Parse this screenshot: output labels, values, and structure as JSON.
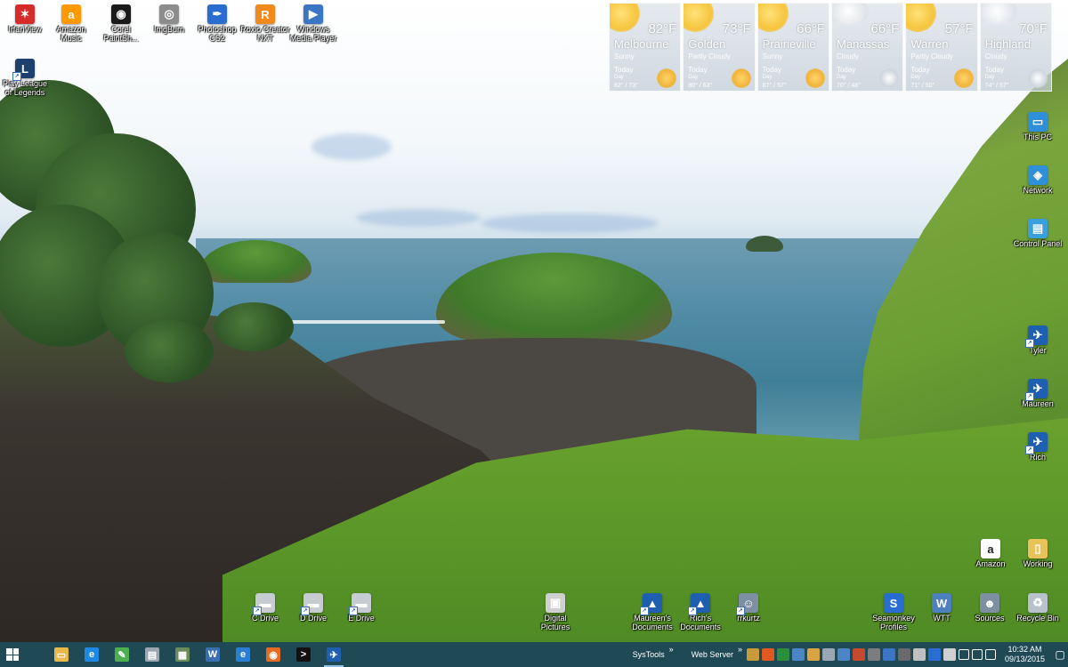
{
  "desktop": {
    "icons_top": [
      {
        "label": "IrfanView",
        "name": "irfanview-icon",
        "color": "#d62b2b",
        "glyph": "✶"
      },
      {
        "label": "Amazon Music",
        "name": "amazon-music-icon",
        "color": "#ff9900",
        "glyph": "a"
      },
      {
        "label": "Corel PaintSh...",
        "name": "corel-paintshop-icon",
        "color": "#1a1a1a",
        "glyph": "◉"
      },
      {
        "label": "ImgBurn",
        "name": "imgburn-icon",
        "color": "#8c8c8c",
        "glyph": "◎"
      },
      {
        "label": "Photoshop CS2",
        "name": "photoshop-icon",
        "color": "#2a6dd1",
        "glyph": "✒"
      },
      {
        "label": "Roxio Creator NXT",
        "name": "roxio-creator-icon",
        "color": "#f08a1c",
        "glyph": "R"
      },
      {
        "label": "Windows Media Player",
        "name": "windows-media-player-icon",
        "color": "#3b76c4",
        "glyph": "▶"
      }
    ],
    "icon_league": {
      "label": "Play League of Legends",
      "name": "league-of-legends-icon",
      "color": "#1c3f6e",
      "glyph": "L"
    },
    "icons_right": [
      {
        "label": "This PC",
        "name": "this-pc-icon",
        "color": "#2f8fd8",
        "glyph": "▭"
      },
      {
        "label": "Network",
        "name": "network-icon",
        "color": "#2f8fd8",
        "glyph": "◈"
      },
      {
        "label": "Control Panel",
        "name": "control-panel-icon",
        "color": "#3aa0dd",
        "glyph": "▤"
      },
      {
        "label": "Tyler",
        "name": "tyler-shortcut-icon",
        "color": "#1f5fb0",
        "glyph": "✈"
      },
      {
        "label": "Maureen",
        "name": "maureen-shortcut-icon",
        "color": "#1f5fb0",
        "glyph": "✈"
      },
      {
        "label": "Rich",
        "name": "rich-shortcut-icon",
        "color": "#1f5fb0",
        "glyph": "✈"
      }
    ],
    "icons_bottom_right": [
      {
        "label": "Amazon",
        "name": "amazon-icon",
        "color": "#ffffff",
        "glyph": "a"
      },
      {
        "label": "Working",
        "name": "working-folder-icon",
        "color": "#e8c35a",
        "glyph": "▯"
      }
    ],
    "icons_bottom": [
      {
        "label": "C Drive",
        "name": "c-drive-icon",
        "color": "#c7ccd2",
        "glyph": "▬"
      },
      {
        "label": "D Drive",
        "name": "d-drive-icon",
        "color": "#c7ccd2",
        "glyph": "▬"
      },
      {
        "label": "E Drive",
        "name": "e-drive-icon",
        "color": "#c7ccd2",
        "glyph": "▬"
      },
      {
        "label": "Digital Pictures",
        "name": "digital-pictures-icon",
        "color": "#d0d0d0",
        "glyph": "▣"
      },
      {
        "label": "Maureen's Documents",
        "name": "maureens-documents-icon",
        "color": "#1f5fb0",
        "glyph": "▲"
      },
      {
        "label": "Rich's Documents",
        "name": "richs-documents-icon",
        "color": "#1f5fb0",
        "glyph": "▲"
      },
      {
        "label": "rrkurtz",
        "name": "rrkurtz-icon",
        "color": "#7d8fa0",
        "glyph": "☺"
      },
      {
        "label": "Seamonkey Profiles",
        "name": "seamonkey-profiles-icon",
        "color": "#2a6dd1",
        "glyph": "S"
      },
      {
        "label": "WTT",
        "name": "wtt-icon",
        "color": "#4e7fbf",
        "glyph": "W"
      },
      {
        "label": "Sources",
        "name": "sources-icon",
        "color": "#7d8fa0",
        "glyph": "☻"
      },
      {
        "label": "Recycle Bin",
        "name": "recycle-bin-icon",
        "color": "#b8c2cc",
        "glyph": "♻"
      }
    ]
  },
  "weather": [
    {
      "temp": "82°F",
      "city": "Melbourne",
      "cond": "Sunny",
      "today": "Today",
      "day": "Day",
      "range": "82° / 73°",
      "icon": "sun"
    },
    {
      "temp": "73°F",
      "city": "Golden",
      "cond": "Partly Cloudy",
      "today": "Today",
      "day": "Day",
      "range": "80° / 63°",
      "icon": "sun"
    },
    {
      "temp": "66°F",
      "city": "Prairieville",
      "cond": "Sunny",
      "today": "Today",
      "day": "Day",
      "range": "87° / 57°",
      "icon": "sun"
    },
    {
      "temp": "66°F",
      "city": "Manassas",
      "cond": "Cloudy",
      "today": "Today",
      "day": "Day",
      "range": "70° / 48°",
      "icon": "cloud"
    },
    {
      "temp": "57°F",
      "city": "Warren",
      "cond": "Partly Cloudy",
      "today": "Today",
      "day": "Day",
      "range": "71° / 50°",
      "icon": "sun"
    },
    {
      "temp": "70°F",
      "city": "Highland",
      "cond": "Cloudy",
      "today": "Today",
      "day": "Day",
      "range": "74° / 57°",
      "icon": "cloud"
    }
  ],
  "taskbar": {
    "pinned": [
      {
        "name": "file-explorer-icon",
        "color": "#e8b84a",
        "glyph": "▭"
      },
      {
        "name": "edge-icon",
        "color": "#1e88e5",
        "glyph": "e"
      },
      {
        "name": "green-app-icon",
        "color": "#4caf50",
        "glyph": "✎"
      },
      {
        "name": "notepad-icon",
        "color": "#9aa6b2",
        "glyph": "▤"
      },
      {
        "name": "calculator-app-icon",
        "color": "#6c8b5a",
        "glyph": "▦"
      },
      {
        "name": "word-doc-icon",
        "color": "#3a6fb3",
        "glyph": "W"
      },
      {
        "name": "internet-explorer-icon",
        "color": "#2a7fd4",
        "glyph": "e"
      },
      {
        "name": "firefox-icon",
        "color": "#e66a1f",
        "glyph": "◉"
      },
      {
        "name": "command-prompt-icon",
        "color": "#111111",
        "glyph": ">"
      },
      {
        "name": "seamonkey-icon",
        "color": "#1f5fb0",
        "glyph": "✈"
      }
    ],
    "toolbars": [
      "SysTools",
      "Web Server"
    ],
    "tray_colors": [
      "#c79a3a",
      "#e05a1f",
      "#2c8e3a",
      "#4a86c5",
      "#d9a441",
      "#9aa6b2",
      "#4a86c5",
      "#c34a2c",
      "#7d7d7d",
      "#3b76c4",
      "#6a6a6a",
      "#c0c0c0",
      "#2a6dd1",
      "#d0d0d0",
      "#ffffff",
      "#ffffff",
      "#ffffff"
    ],
    "clock": {
      "time": "10:32 AM",
      "date": "09/13/2015"
    }
  }
}
